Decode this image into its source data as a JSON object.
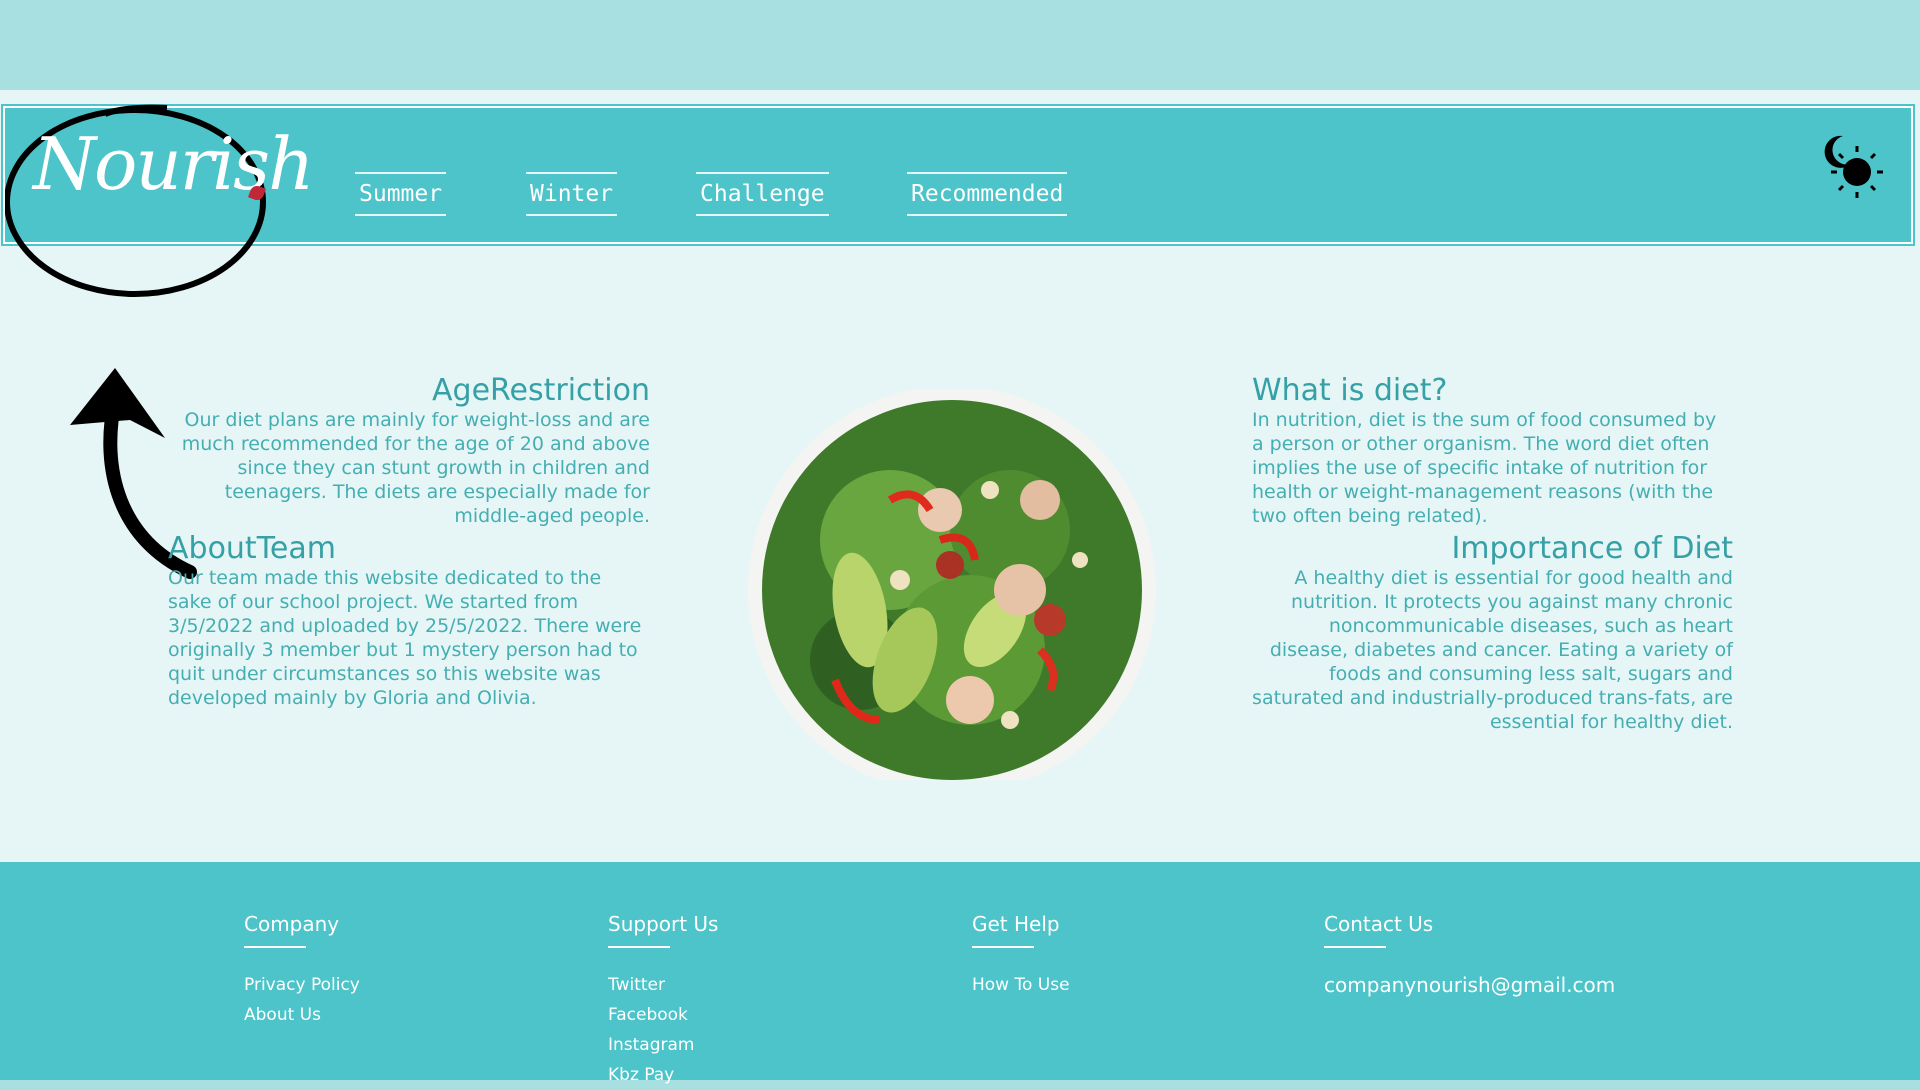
{
  "logo": {
    "text": "Nourish"
  },
  "nav": {
    "items": [
      "Summer",
      "Winter",
      "Challenge",
      "Recommended"
    ]
  },
  "theme_toggle": {
    "icon": "moon-sun-icon"
  },
  "age_restriction": {
    "title": "AgeRestriction",
    "body": "Our diet plans are mainly for weight-loss and are much recommended for the age of 20 and above since they can stunt growth in children and teenagers. The diets are especially made for middle-aged people."
  },
  "about_team": {
    "title": "AboutTeam",
    "body": "Our team made this website dedicated to the sake of our school project. We started from 3/5/2022 and uploaded by 25/5/2022. There were originally 3 member but 1 mystery person had to quit under circumstances so this website was developed mainly by Gloria and Olivia."
  },
  "what_is_diet": {
    "title": "What is diet?",
    "body": "In nutrition, diet is the sum of food consumed by a person or other organism. The word diet often implies the use of specific intake of nutrition for health or weight-management reasons (with the two often being related)."
  },
  "importance": {
    "title": "Importance of Diet",
    "body": "A healthy diet is essential for good health and nutrition. It protects you against many chronic noncommunicable diseases, such as heart disease, diabetes and cancer. Eating a variety of foods and consuming less salt, sugars and saturated and industrially-produced trans-fats, are essential for healthy diet."
  },
  "footer": {
    "company": {
      "title": "Company",
      "links": [
        "Privacy Policy",
        "About Us"
      ]
    },
    "support": {
      "title": "Support Us",
      "links": [
        "Twitter",
        "Facebook",
        "Instagram",
        "Kbz Pay"
      ]
    },
    "help": {
      "title": "Get Help",
      "links": [
        "How To Use"
      ]
    },
    "contact": {
      "title": "Contact Us",
      "email": "companynourish@gmail.com"
    }
  },
  "colors": {
    "accent": "#4cc4c9",
    "text": "#3aa6ab",
    "background": "#e6f6f6",
    "outer": "#a8dfe0"
  }
}
